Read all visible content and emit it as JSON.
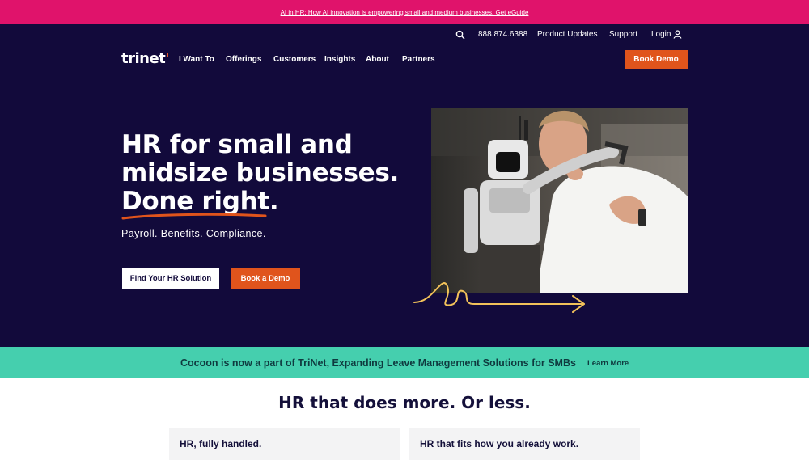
{
  "promo": {
    "text": "AI in HR: How AI innovation is empowering small and medium businesses. Get eGuide"
  },
  "utility": {
    "search_icon": "search-icon",
    "phone": "888.874.6388",
    "product_updates": "Product Updates",
    "support": "Support",
    "login": "Login",
    "login_icon": "person-icon"
  },
  "brand": {
    "logo_text": "trinet"
  },
  "nav": {
    "items": [
      "I Want To",
      "Offerings",
      "Customers",
      "Insights",
      "About",
      "Partners"
    ],
    "cta": "Book Demo"
  },
  "hero": {
    "headline_lines": [
      "HR for small and",
      "midsize businesses.",
      "Done right."
    ],
    "subhead": "Payroll. Benefits. Compliance.",
    "primary_button": "Find Your HR Solution",
    "secondary_button": "Book a Demo"
  },
  "banner": {
    "text": "Cocoon is now a part of TriNet, Expanding Leave Management Solutions for SMBs",
    "link": "Learn More"
  },
  "section": {
    "title_bold": "HR that does more.",
    "title_rest": " Or less."
  },
  "cards": [
    {
      "title": "HR, fully handled."
    },
    {
      "title": "HR that fits how you already work."
    }
  ],
  "colors": {
    "navy": "#120a3b",
    "promo_pink": "#e0136b",
    "accent_orange": "#e0541c",
    "banner_teal": "#45cfae",
    "squiggle_gold": "#f2c25a"
  }
}
